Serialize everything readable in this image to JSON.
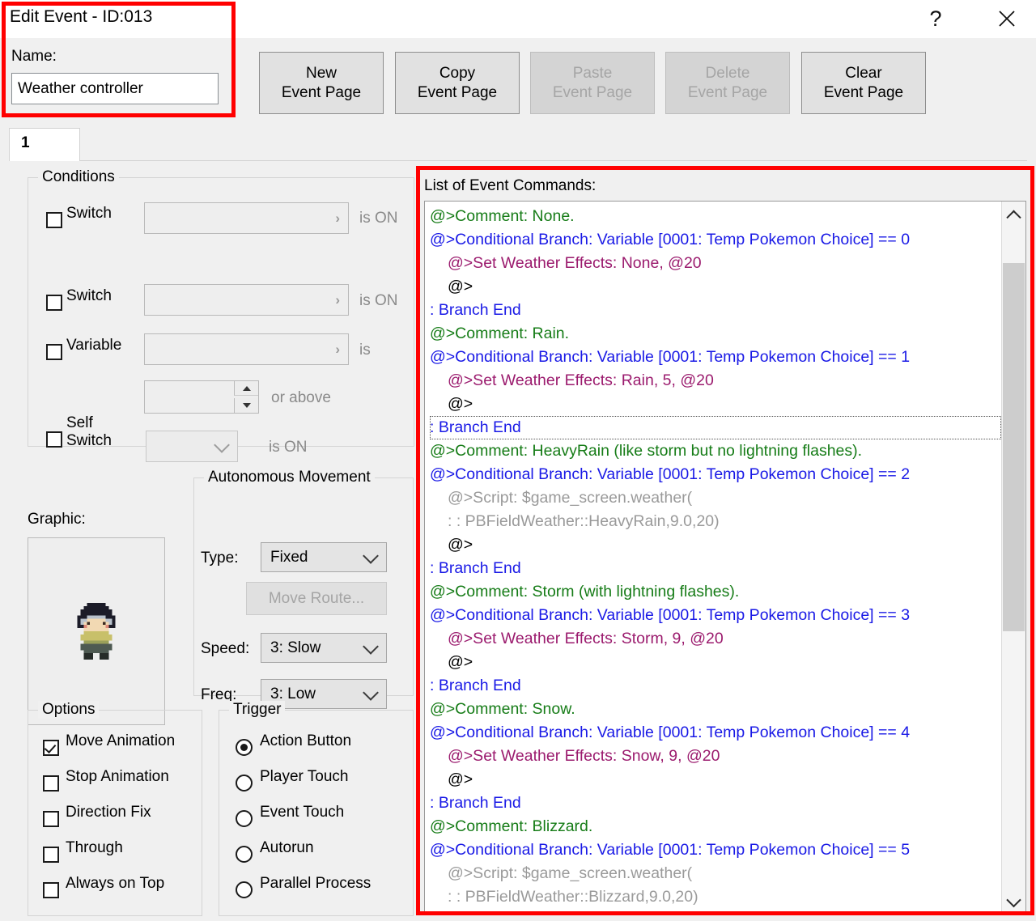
{
  "window": {
    "title": "Edit Event - ID:013",
    "help_icon": "?",
    "close_icon": "close-icon"
  },
  "name_field": {
    "label": "Name:",
    "value": "Weather controller",
    "placeholder": ""
  },
  "page_buttons": [
    {
      "id": "new",
      "line1": "New",
      "line2": "Event Page",
      "enabled": true
    },
    {
      "id": "copy",
      "line1": "Copy",
      "line2": "Event Page",
      "enabled": true
    },
    {
      "id": "paste",
      "line1": "Paste",
      "line2": "Event Page",
      "enabled": false
    },
    {
      "id": "delete",
      "line1": "Delete",
      "line2": "Event Page",
      "enabled": false
    },
    {
      "id": "clear",
      "line1": "Clear",
      "line2": "Event Page",
      "enabled": true
    }
  ],
  "tabs": [
    {
      "label": "1",
      "active": true
    }
  ],
  "conditions": {
    "title": "Conditions",
    "rows": [
      {
        "label": "Switch",
        "checked": false,
        "field_value": "",
        "suffix": "is ON"
      },
      {
        "label": "Switch",
        "checked": false,
        "field_value": "",
        "suffix": "is ON"
      },
      {
        "label": "Variable",
        "checked": false,
        "field_value": "",
        "suffix": "is"
      },
      {
        "label": "",
        "checked": null,
        "field_value": "",
        "suffix": "or above"
      },
      {
        "label": "Self\nSwitch",
        "checked": false,
        "field_value": "",
        "suffix": "is ON"
      }
    ],
    "self_switch_line1": "Self",
    "self_switch_line2": "Switch"
  },
  "graphic": {
    "label": "Graphic:",
    "sprite_name": "character-sprite"
  },
  "movement": {
    "title": "Autonomous Movement",
    "type_label": "Type:",
    "type_value": "Fixed",
    "move_route_label": "Move Route...",
    "move_route_enabled": false,
    "speed_label": "Speed:",
    "speed_value": "3: Slow",
    "freq_label": "Freq:",
    "freq_value": "3: Low"
  },
  "options": {
    "title": "Options",
    "items": [
      {
        "label": "Move Animation",
        "checked": true
      },
      {
        "label": "Stop Animation",
        "checked": false
      },
      {
        "label": "Direction Fix",
        "checked": false
      },
      {
        "label": "Through",
        "checked": false
      },
      {
        "label": "Always on Top",
        "checked": false
      }
    ]
  },
  "trigger": {
    "title": "Trigger",
    "items": [
      {
        "label": "Action Button",
        "selected": true
      },
      {
        "label": "Player Touch",
        "selected": false
      },
      {
        "label": "Event Touch",
        "selected": false
      },
      {
        "label": "Autorun",
        "selected": false
      },
      {
        "label": "Parallel Process",
        "selected": false
      }
    ]
  },
  "command_list": {
    "label": "List of Event Commands:",
    "lines": [
      {
        "text": "@>Comment: None.",
        "color": "green",
        "indent": 0,
        "focused": false
      },
      {
        "text": "@>Conditional Branch: Variable [0001: Temp Pokemon Choice] == 0",
        "color": "blue",
        "indent": 0,
        "focused": false
      },
      {
        "text": "@>Set Weather Effects: None, @20",
        "color": "purple",
        "indent": 1,
        "focused": false
      },
      {
        "text": "@>",
        "color": "black",
        "indent": 1,
        "focused": false
      },
      {
        "text": ":  Branch End",
        "color": "blue",
        "indent": 0,
        "focused": false
      },
      {
        "text": "@>Comment: Rain.",
        "color": "green",
        "indent": 0,
        "focused": false
      },
      {
        "text": "@>Conditional Branch: Variable [0001: Temp Pokemon Choice] == 1",
        "color": "blue",
        "indent": 0,
        "focused": false
      },
      {
        "text": "@>Set Weather Effects: Rain, 5, @20",
        "color": "purple",
        "indent": 1,
        "focused": false
      },
      {
        "text": "@>",
        "color": "black",
        "indent": 1,
        "focused": false
      },
      {
        "text": ":  Branch End",
        "color": "blue",
        "indent": 0,
        "focused": true
      },
      {
        "text": "@>Comment: HeavyRain (like storm but no lightning flashes).",
        "color": "green",
        "indent": 0,
        "focused": false
      },
      {
        "text": "@>Conditional Branch: Variable [0001: Temp Pokemon Choice] == 2",
        "color": "blue",
        "indent": 0,
        "focused": false
      },
      {
        "text": "@>Script: $game_screen.weather(",
        "color": "gray",
        "indent": 1,
        "focused": false
      },
      {
        "text": ":        :    PBFieldWeather::HeavyRain,9.0,20)",
        "color": "gray",
        "indent": 1,
        "focused": false
      },
      {
        "text": "@>",
        "color": "black",
        "indent": 1,
        "focused": false
      },
      {
        "text": ":  Branch End",
        "color": "blue",
        "indent": 0,
        "focused": false
      },
      {
        "text": "@>Comment: Storm (with lightning flashes).",
        "color": "green",
        "indent": 0,
        "focused": false
      },
      {
        "text": "@>Conditional Branch: Variable [0001: Temp Pokemon Choice] == 3",
        "color": "blue",
        "indent": 0,
        "focused": false
      },
      {
        "text": "@>Set Weather Effects: Storm, 9, @20",
        "color": "purple",
        "indent": 1,
        "focused": false
      },
      {
        "text": "@>",
        "color": "black",
        "indent": 1,
        "focused": false
      },
      {
        "text": ":  Branch End",
        "color": "blue",
        "indent": 0,
        "focused": false
      },
      {
        "text": "@>Comment: Snow.",
        "color": "green",
        "indent": 0,
        "focused": false
      },
      {
        "text": "@>Conditional Branch: Variable [0001: Temp Pokemon Choice] == 4",
        "color": "blue",
        "indent": 0,
        "focused": false
      },
      {
        "text": "@>Set Weather Effects: Snow, 9, @20",
        "color": "purple",
        "indent": 1,
        "focused": false
      },
      {
        "text": "@>",
        "color": "black",
        "indent": 1,
        "focused": false
      },
      {
        "text": ":  Branch End",
        "color": "blue",
        "indent": 0,
        "focused": false
      },
      {
        "text": "@>Comment: Blizzard.",
        "color": "green",
        "indent": 0,
        "focused": false
      },
      {
        "text": "@>Conditional Branch: Variable [0001: Temp Pokemon Choice] == 5",
        "color": "blue",
        "indent": 0,
        "focused": false
      },
      {
        "text": "@>Script: $game_screen.weather(",
        "color": "gray",
        "indent": 1,
        "focused": false
      },
      {
        "text": ":        :    PBFieldWeather::Blizzard,9.0,20)",
        "color": "gray",
        "indent": 1,
        "focused": false
      }
    ],
    "scrollbar": {
      "up_icon": "chevron-up-icon",
      "down_icon": "chevron-down-icon"
    }
  },
  "annotations": {
    "accent_color": "#ff0000",
    "boxes": [
      "name-area-highlight",
      "command-list-highlight"
    ]
  }
}
